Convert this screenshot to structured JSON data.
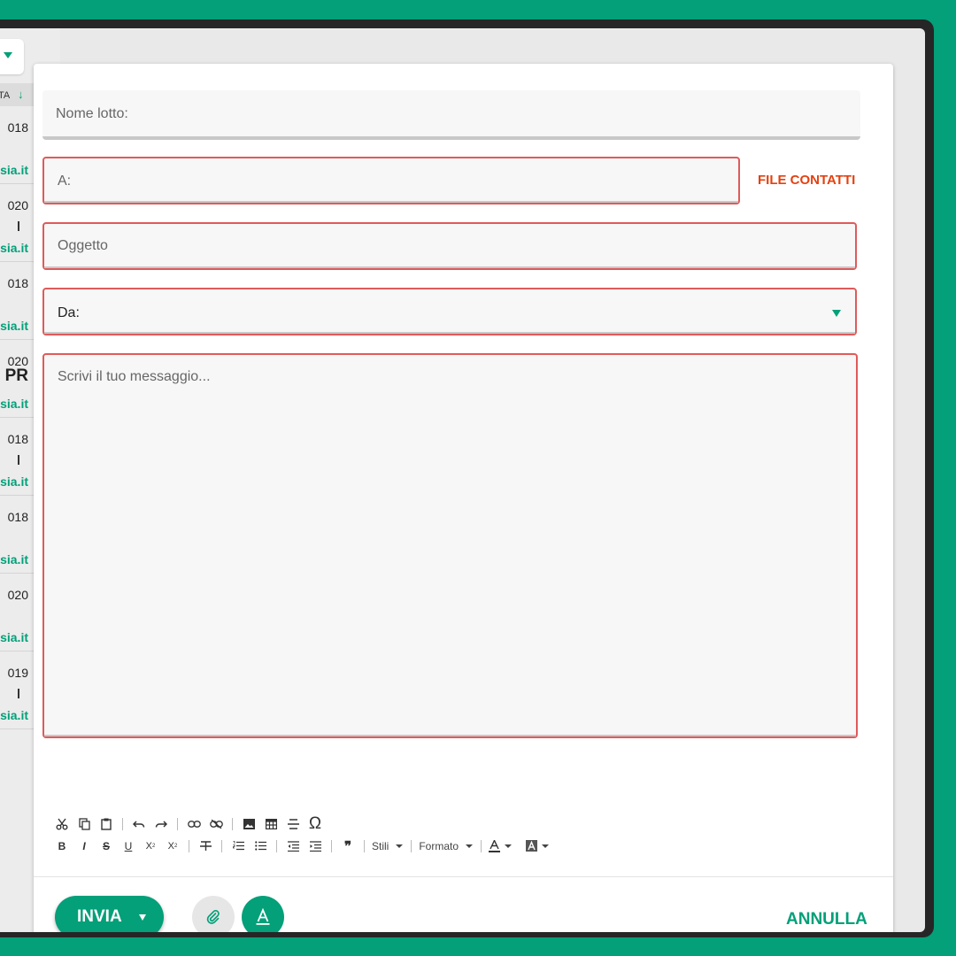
{
  "list": {
    "sort_label": "TA",
    "sort_arrow": "↓",
    "items": [
      {
        "date": "018",
        "big": "",
        "domain": "sia.it",
        "bar": false
      },
      {
        "date": "020",
        "big": "",
        "domain": "sia.it",
        "bar": true
      },
      {
        "date": "018",
        "big": "",
        "domain": "sia.it",
        "bar": false
      },
      {
        "date": "020",
        "big": "PR",
        "domain": "sia.it",
        "bar": false
      },
      {
        "date": "018",
        "big": "",
        "domain": "sia.it",
        "bar": true
      },
      {
        "date": "018",
        "big": "",
        "domain": "sia.it",
        "bar": false
      },
      {
        "date": "020",
        "big": "",
        "domain": "sia.it",
        "bar": false
      },
      {
        "date": "019",
        "big": "",
        "domain": "sia.it",
        "bar": true
      }
    ]
  },
  "composer": {
    "nome_lotto_placeholder": "Nome lotto:",
    "to_placeholder": "A:",
    "file_contatti_label": "FILE CONTATTI",
    "subject_placeholder": "Oggetto",
    "from_label": "Da:",
    "message_placeholder": "Scrivi il tuo messaggio..."
  },
  "toolbar": {
    "styles_label": "Stili",
    "format_label": "Formato"
  },
  "footer": {
    "send_label": "INVIA",
    "cancel_label": "ANNULLA"
  },
  "colors": {
    "accent": "#03a079",
    "error_border": "#e05a5a",
    "file_contatti": "#e5400f"
  },
  "icons": [
    "cut-icon",
    "copy-icon",
    "paste-icon",
    "undo-icon",
    "redo-icon",
    "link-icon",
    "unlink-icon",
    "image-icon",
    "table-icon",
    "horizontal-line-icon",
    "special-char-icon",
    "bold-icon",
    "italic-icon",
    "strikethrough-icon",
    "underline-icon",
    "subscript-icon",
    "superscript-icon",
    "remove-format-icon",
    "numbered-list-icon",
    "bulleted-list-icon",
    "outdent-icon",
    "indent-icon",
    "blockquote-icon",
    "text-color-icon",
    "background-color-icon",
    "attach-icon",
    "text-format-icon"
  ]
}
